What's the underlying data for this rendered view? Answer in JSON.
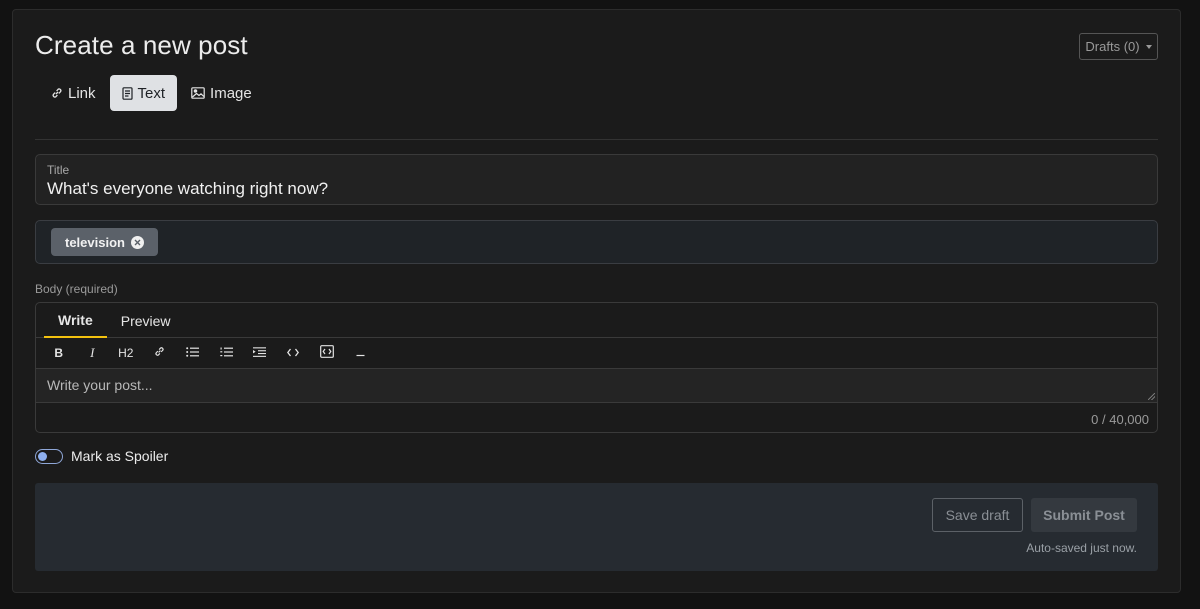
{
  "header": {
    "title": "Create a new post",
    "drafts_label": "Drafts (0)"
  },
  "post_types": [
    {
      "label": "Link",
      "icon": "link-icon",
      "active": false
    },
    {
      "label": "Text",
      "icon": "document-icon",
      "active": true
    },
    {
      "label": "Image",
      "icon": "image-icon",
      "active": false
    }
  ],
  "title_field": {
    "label": "Title",
    "value": "What's everyone watching right now?"
  },
  "tags": [
    {
      "label": "television"
    }
  ],
  "body": {
    "label": "Body (required)",
    "tabs": [
      {
        "label": "Write",
        "active": true
      },
      {
        "label": "Preview",
        "active": false
      }
    ],
    "toolbar": {
      "bold": "B",
      "italic": "I",
      "heading": "H2",
      "link_icon": "link-icon",
      "bullet_list_icon": "bullet-list-icon",
      "numbered_list_icon": "numbered-list-icon",
      "indent_icon": "indent-icon",
      "code_icon": "code-icon",
      "code_block_icon": "code-block-icon",
      "hr_icon": "horizontal-rule-icon"
    },
    "placeholder": "Write your post...",
    "char_count": "0 / 40,000"
  },
  "spoiler": {
    "label": "Mark as Spoiler",
    "checked": false
  },
  "footer": {
    "save_draft_label": "Save draft",
    "submit_label": "Submit Post",
    "autosave_text": "Auto-saved just now."
  },
  "colors": {
    "accent_underline": "#f3c20f",
    "toggle_accent": "#8fb0ef"
  }
}
